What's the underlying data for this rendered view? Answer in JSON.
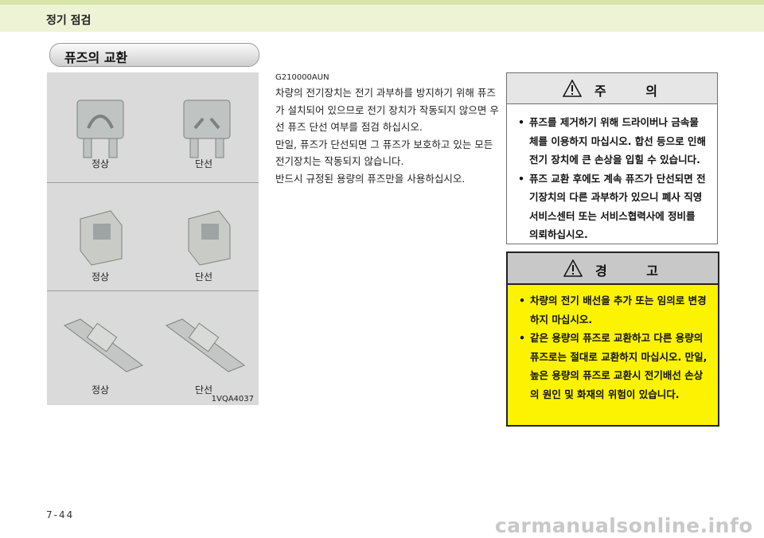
{
  "header": {
    "title": "정기 점검"
  },
  "section": {
    "title": "퓨즈의 교환"
  },
  "figure": {
    "rows": [
      {
        "normal": "정상",
        "blown": "단선"
      },
      {
        "normal": "정상",
        "blown": "단선"
      },
      {
        "normal": "정상",
        "blown": "단선"
      }
    ],
    "code": "1VQA4037"
  },
  "body": {
    "code": "G210000AUN",
    "paragraphs": [
      "차량의 전기장치는 전기 과부하를 방지하기 위해 퓨즈가 설치되어 있으므로 전기 장치가 작동되지 않으면 우선 퓨즈 단선 여부를 점검 하십시오.",
      "만일, 퓨즈가 단선되면 그 퓨즈가 보호하고 있는 모든 전기장치는 작동되지 않습니다.",
      "반드시 규정된 용량의 퓨즈만을 사용하십시오."
    ]
  },
  "caution": {
    "title": "주 의",
    "items": [
      "퓨즈를 제거하기 위해 드라이버나 금속물체를 이용하지 마십시오. 합선 등으로 인해 전기 장치에 큰 손상을 입힐 수 있습니다.",
      "퓨즈 교환 후에도 계속 퓨즈가 단선되면 전기장치의 다른 과부하가 있으니 폐사 직영 서비스센터 또는 서비스협력사에 정비를 의뢰하십시오."
    ]
  },
  "warning": {
    "title": "경 고",
    "items": [
      "차량의 전기 배선을 추가 또는 임의로 변경하지 마십시오.",
      "같은 용량의 퓨즈로 교환하고 다른 용량의 퓨즈로는 절대로 교환하지 마십시오. 만일, 높은 용량의 퓨즈로 교환시 전기배선 손상의 원인 및 화재의 위험이 있습니다."
    ]
  },
  "footer": {
    "page": "7-44",
    "watermark": "carmanualsonline.info"
  },
  "colors": {
    "warning_bg": "#fbf301",
    "header_bg": "#eef3d6"
  }
}
